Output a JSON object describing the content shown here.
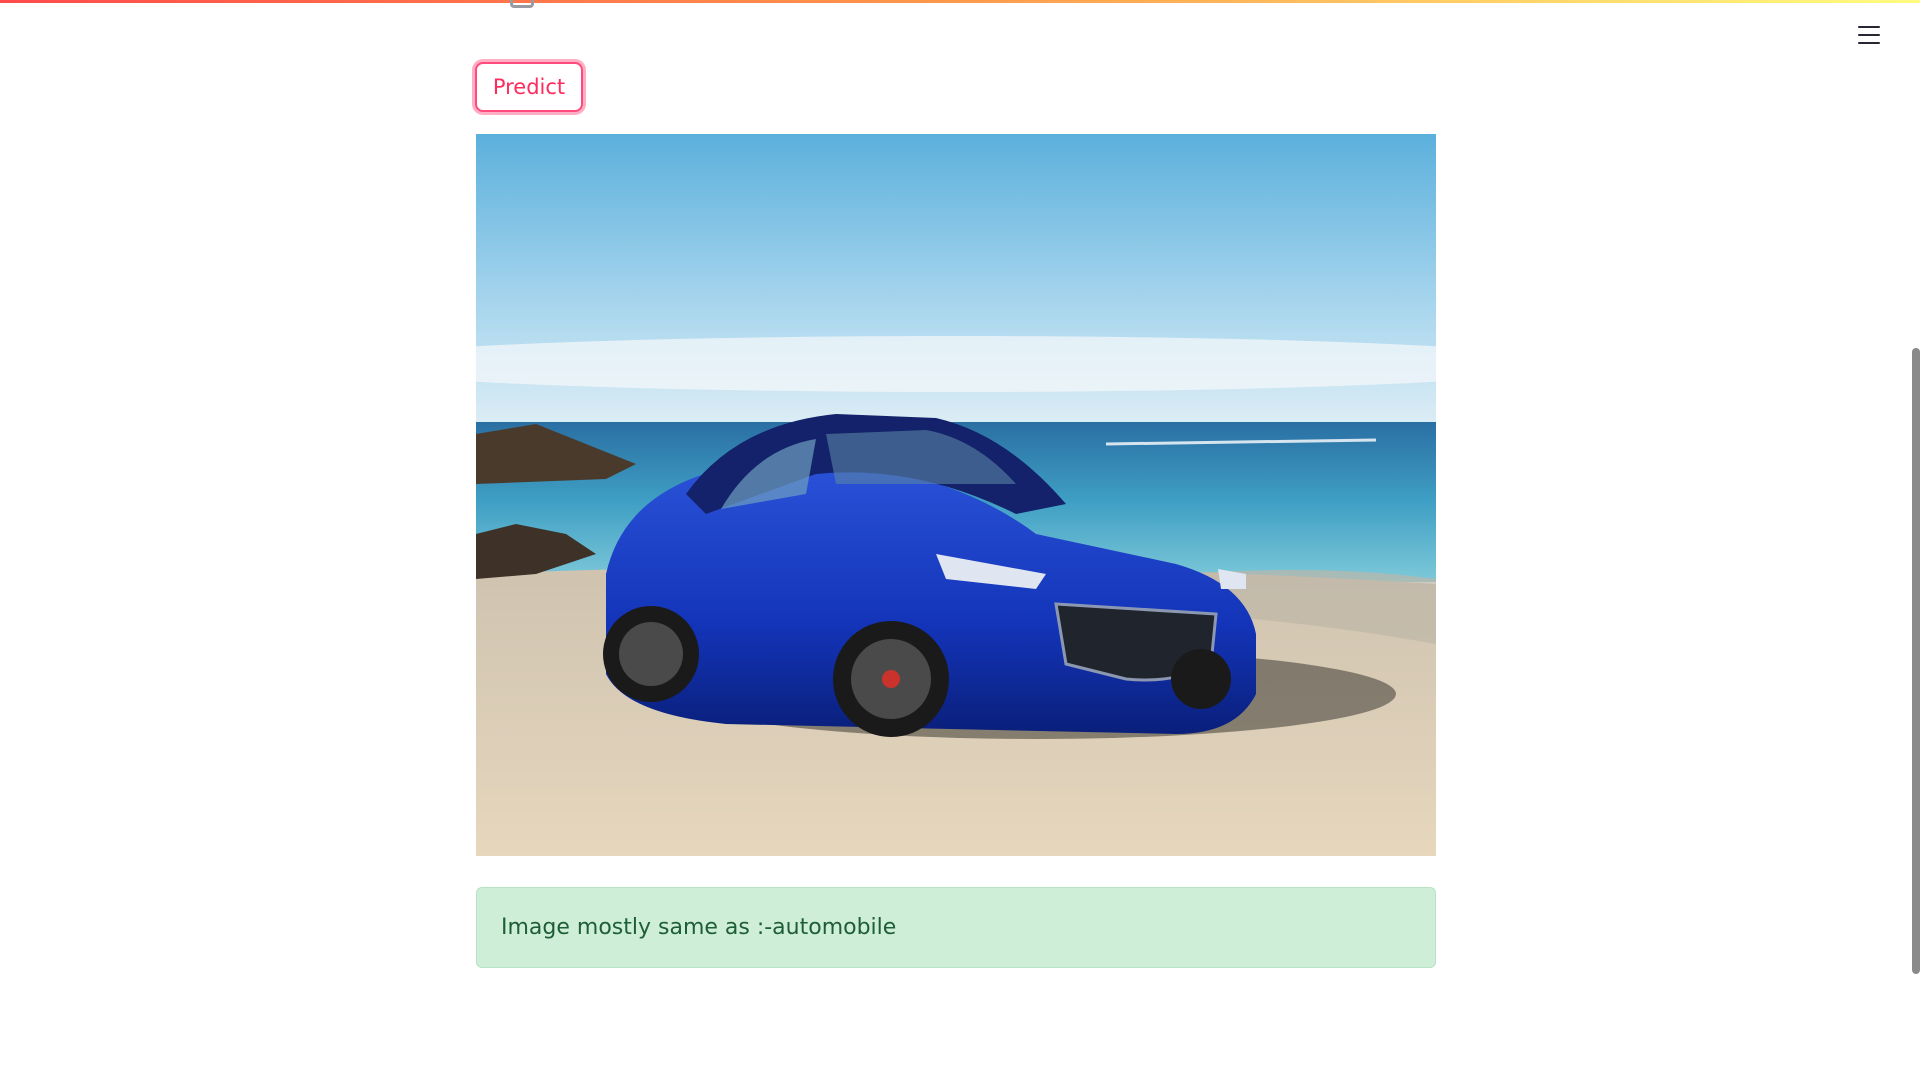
{
  "toolbar": {
    "predict_label": "Predict"
  },
  "photo": {
    "subject": "blue sedan parked on a sandy beach by the sea"
  },
  "result": {
    "message": "Image mostly same as :-automobile"
  },
  "colors": {
    "accent": "#ff4b7d",
    "alert_background": "#cfeed7",
    "alert_text": "#1e5e36"
  },
  "icons": {
    "menu": "hamburger-menu-icon"
  }
}
